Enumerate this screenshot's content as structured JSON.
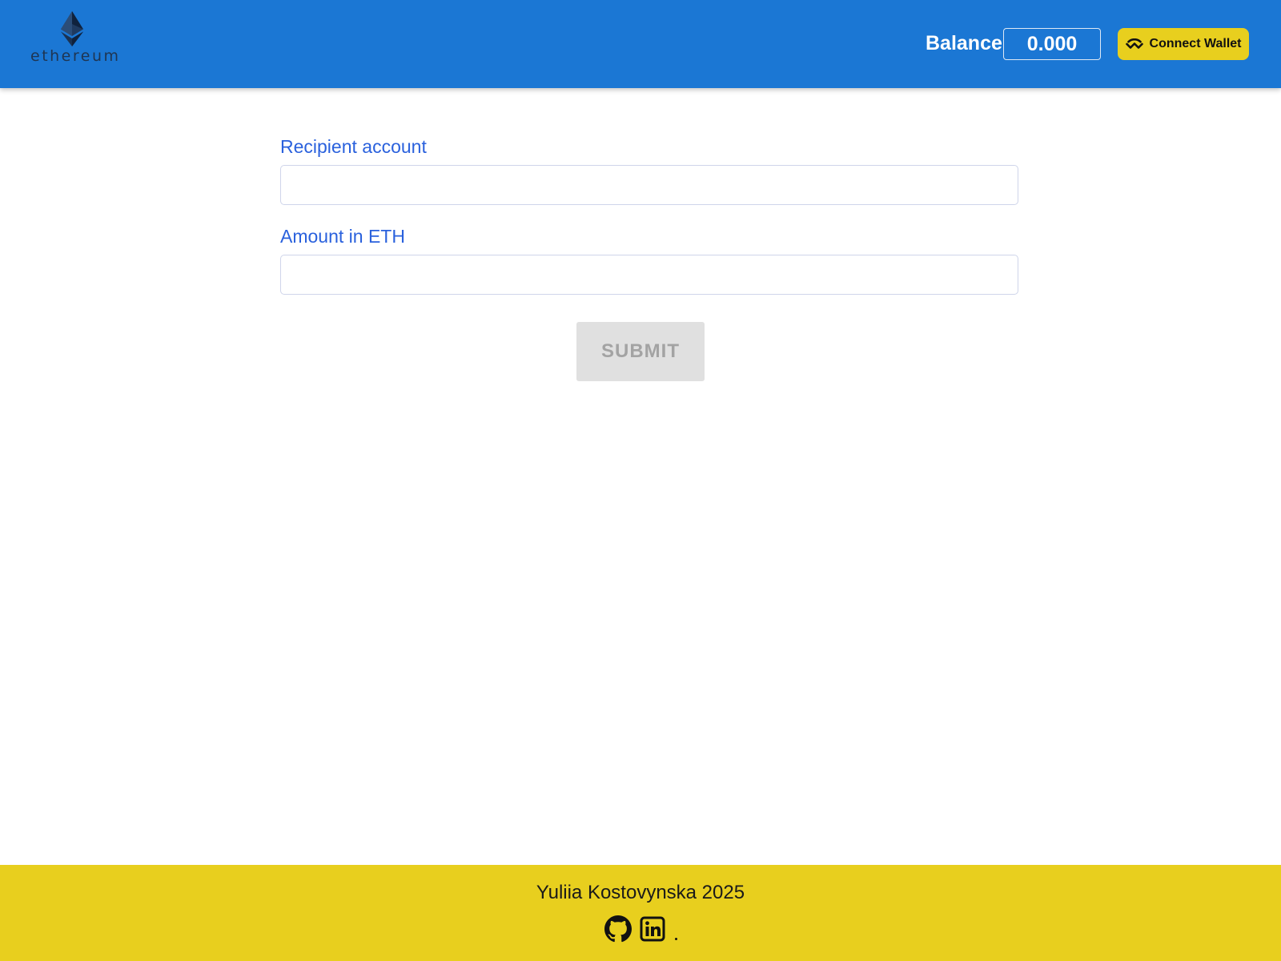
{
  "header": {
    "logo_word": "ethereum",
    "balance_label": "Balance",
    "balance_value": "0.000",
    "connect_label": "Connect Wallet",
    "connect_icon": "walletconnect-icon"
  },
  "form": {
    "recipient_label": "Recipient account",
    "recipient_value": "",
    "amount_label": "Amount in ETH",
    "amount_value": "",
    "submit_label": "SUBMIT"
  },
  "footer": {
    "credit": "Yuliia Kostovynska 2025",
    "icons": [
      "github-icon",
      "linkedin-icon"
    ]
  },
  "colors": {
    "header_bg": "#1b77d4",
    "accent_yellow": "#e8cf1e",
    "label_blue": "#2a61dd",
    "submit_disabled_bg": "#e0e0e0"
  }
}
